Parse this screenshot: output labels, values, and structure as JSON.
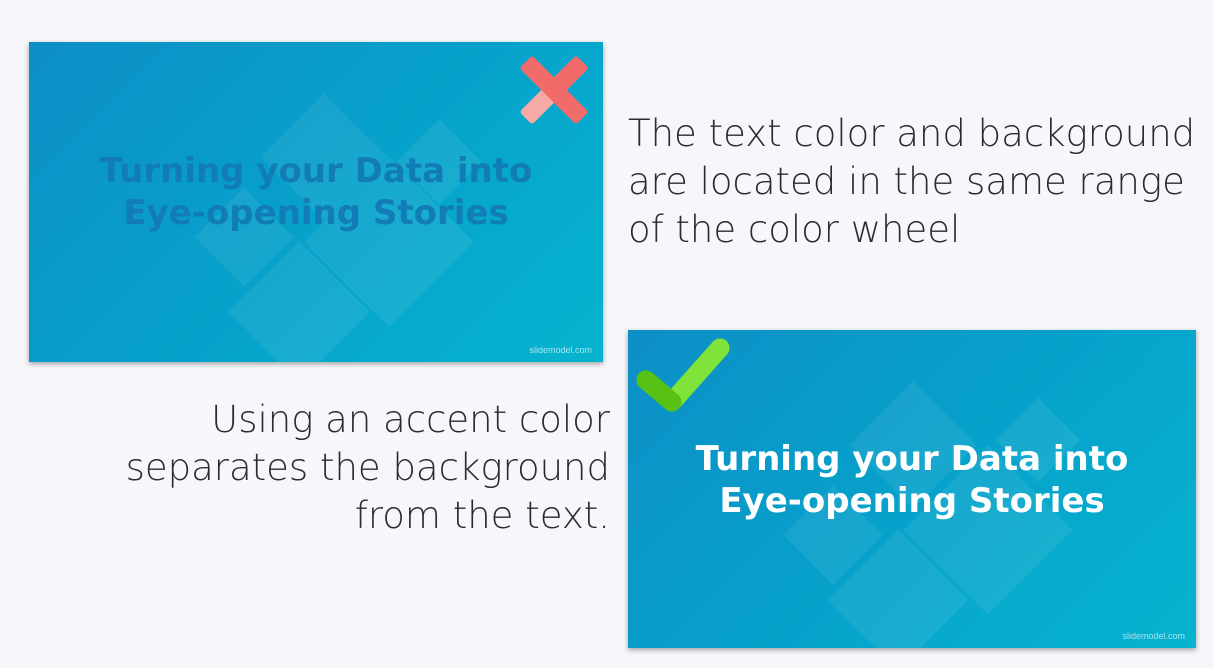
{
  "examples": {
    "bad": {
      "slide_title_lines": [
        "Turning your Data into",
        "Eye-opening Stories"
      ],
      "watermark": "slidemodel.com",
      "caption_lines": [
        "The text color and background",
        "are located in the same range",
        "of the color wheel"
      ],
      "icon": "cross-icon",
      "title_color": "#127cb6",
      "icon_color": "#f26b6b"
    },
    "good": {
      "slide_title_lines": [
        "Turning your Data into",
        "Eye-opening Stories"
      ],
      "watermark": "slidemodel.com",
      "caption_lines": [
        "Using an accent color",
        "separates the background",
        "from the text."
      ],
      "icon": "checkmark-icon",
      "title_color": "#ffffff",
      "icon_color": "#66d41e"
    }
  },
  "colors": {
    "page_background": "#f6f7fb",
    "slide_gradient_start": "#0e8fc6",
    "slide_gradient_end": "#06b4cf",
    "caption_text": "#2b2b2b"
  }
}
